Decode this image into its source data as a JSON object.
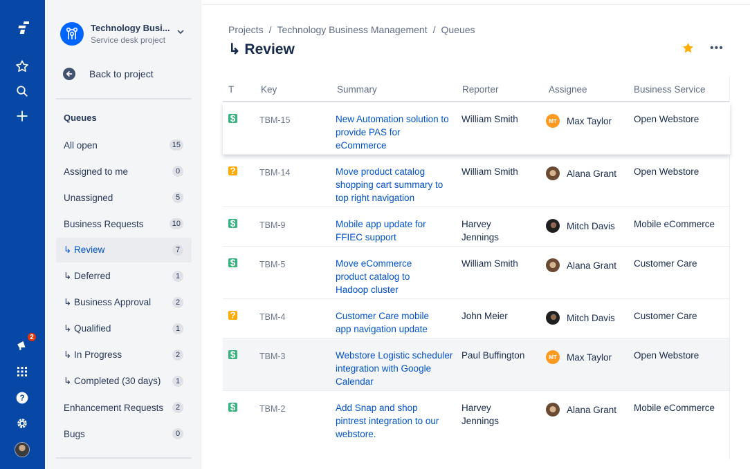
{
  "global_nav": {
    "notification_count": "2"
  },
  "project": {
    "name": "Technology Busi...",
    "type": "Service desk project",
    "back_label": "Back to project"
  },
  "queues": {
    "heading": "Queues",
    "items": [
      {
        "label": "All open",
        "count": "15"
      },
      {
        "label": "Assigned to me",
        "count": "0"
      },
      {
        "label": "Unassigned",
        "count": "5"
      },
      {
        "label": "Business Requests",
        "count": "10"
      },
      {
        "label": "↳ Review",
        "count": "7"
      },
      {
        "label": "↳ Deferred",
        "count": "1"
      },
      {
        "label": "↳ Business Approval",
        "count": "2"
      },
      {
        "label": "↳ Qualified",
        "count": "1"
      },
      {
        "label": "↳ In Progress",
        "count": "2"
      },
      {
        "label": "↳ Completed (30 days)",
        "count": "1"
      },
      {
        "label": "Enhancement Requests",
        "count": "2"
      },
      {
        "label": "Bugs",
        "count": "0"
      }
    ]
  },
  "breadcrumb": [
    "Projects",
    "Technology Business Management",
    "Queues"
  ],
  "page_title": "↳ Review",
  "more_label": "•••",
  "table": {
    "columns": [
      "T",
      "Key",
      "Summary",
      "Reporter",
      "Assignee",
      "Business Service"
    ],
    "rows": [
      {
        "type_glyph": "$",
        "key": "TBM-15",
        "summary": "New Automation solution to provide PAS for eCommerce",
        "reporter": "William Smith",
        "assignee_initials": "MT",
        "assignee": "Max Taylor",
        "service": "Open Webstore"
      },
      {
        "type_glyph": "?",
        "key": "TBM-14",
        "summary": "Move product catalog shopping cart summary to top right navigation",
        "reporter": "William Smith",
        "assignee_initials": "",
        "assignee": "Alana Grant",
        "service": "Open Webstore"
      },
      {
        "type_glyph": "$",
        "key": "TBM-9",
        "summary": "Mobile app update for FFIEC support",
        "reporter": "Harvey Jennings",
        "assignee_initials": "",
        "assignee": "Mitch Davis",
        "service": "Mobile eCommerce"
      },
      {
        "type_glyph": "$",
        "key": "TBM-5",
        "summary": "Move eCommerce product catalog to Hadoop cluster",
        "reporter": "William Smith",
        "assignee_initials": "",
        "assignee": "Alana Grant",
        "service": "Customer Care"
      },
      {
        "type_glyph": "?",
        "key": "TBM-4",
        "summary": "Customer Care mobile app navigation update",
        "reporter": "John Meier",
        "assignee_initials": "",
        "assignee": "Mitch Davis",
        "service": "Customer Care"
      },
      {
        "type_glyph": "$",
        "key": "TBM-3",
        "summary": "Webstore Logistic scheduler integration with Google Calendar",
        "reporter": "Paul Buffington",
        "assignee_initials": "MT",
        "assignee": "Max Taylor",
        "service": "Open Webstore"
      },
      {
        "type_glyph": "$",
        "key": "TBM-2",
        "summary": "Add Snap and shop pintrest integration to our webstore.",
        "reporter": "Harvey Jennings",
        "assignee_initials": "",
        "assignee": "Alana Grant",
        "service": "Mobile eCommerce"
      }
    ]
  },
  "colors": {
    "nav_bg": "#0747A6",
    "link": "#0052CC",
    "type_money": "#36B37E",
    "type_idea": "#FFAB00",
    "star": "#FFAB00",
    "badge": "#DE350B"
  }
}
